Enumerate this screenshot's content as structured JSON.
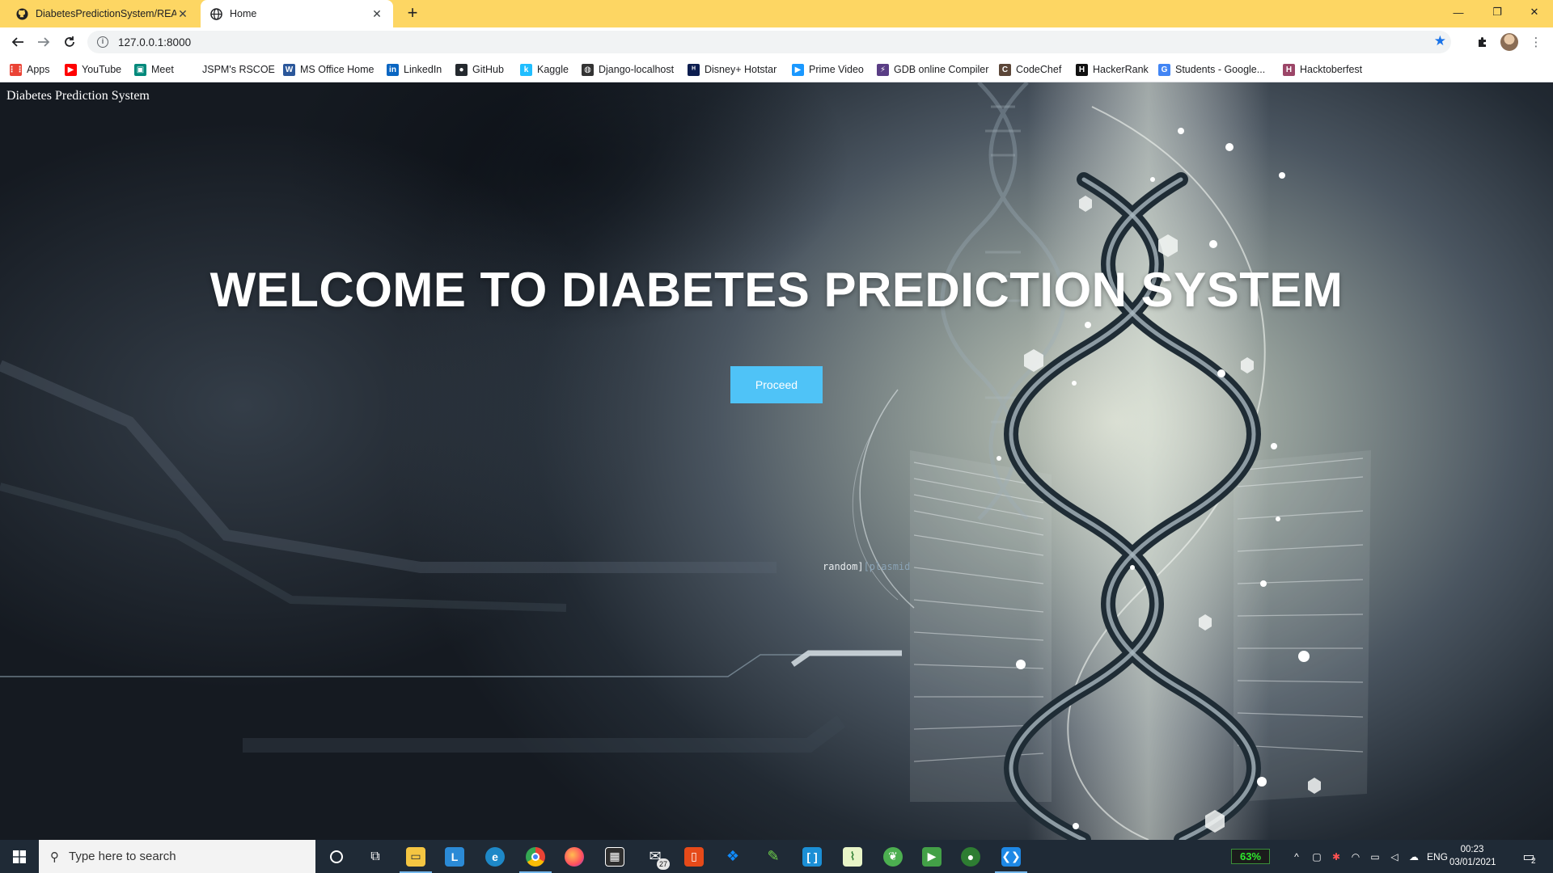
{
  "browser": {
    "tabs": [
      {
        "title": "DiabetesPredictionSystem/README.md",
        "icon": "github-icon",
        "active": false
      },
      {
        "title": "Home",
        "icon": "globe-icon",
        "active": true
      }
    ],
    "url": "127.0.0.1:8000",
    "bookmarks": [
      {
        "label": "Apps",
        "icon": "apps-grid-icon",
        "color": "#ea4335"
      },
      {
        "label": "YouTube",
        "icon": "youtube-icon",
        "color": "#ff0000"
      },
      {
        "label": "Meet",
        "icon": "meet-icon",
        "color": "#00897b"
      },
      {
        "label": "JSPM's RSCOE",
        "icon": "",
        "color": ""
      },
      {
        "label": "MS Office Home",
        "icon": "word-icon",
        "color": "#2b579a"
      },
      {
        "label": "LinkedIn",
        "icon": "linkedin-icon",
        "color": "#0a66c2"
      },
      {
        "label": "GitHub",
        "icon": "github-icon",
        "color": "#24292e"
      },
      {
        "label": "Kaggle",
        "icon": "kaggle-icon",
        "color": "#20beff"
      },
      {
        "label": "Django-localhost",
        "icon": "globe-icon",
        "color": "#333333"
      },
      {
        "label": "Disney+ Hotstar",
        "icon": "hotstar-icon",
        "color": "#0c1d4f"
      },
      {
        "label": "Prime Video",
        "icon": "prime-video-icon",
        "color": "#1a98ff"
      },
      {
        "label": "GDB online Compiler",
        "icon": "gdb-icon",
        "color": "#5a3e85"
      },
      {
        "label": "CodeChef",
        "icon": "codechef-icon",
        "color": "#5b4638"
      },
      {
        "label": "HackerRank",
        "icon": "hackerrank-icon",
        "color": "#111111"
      },
      {
        "label": "Students - Google...",
        "icon": "google-icon",
        "color": "#4285f4"
      },
      {
        "label": "Hacktoberfest",
        "icon": "hacktoberfest-icon",
        "color": "#9c4668"
      }
    ]
  },
  "page": {
    "site_title": "Diabetes Prediction System",
    "heading": "WELCOME TO DIABETES PREDICTION SYSTEM",
    "proceed_label": "Proceed",
    "plasmid_label_a": "random]",
    "plasmid_label_b": "[plasmid"
  },
  "taskbar": {
    "search_placeholder": "Type here to search",
    "mail_badge": "27",
    "battery": "63%",
    "language": "ENG",
    "time": "00:23",
    "date": "03/01/2021",
    "notification_count": "2"
  }
}
